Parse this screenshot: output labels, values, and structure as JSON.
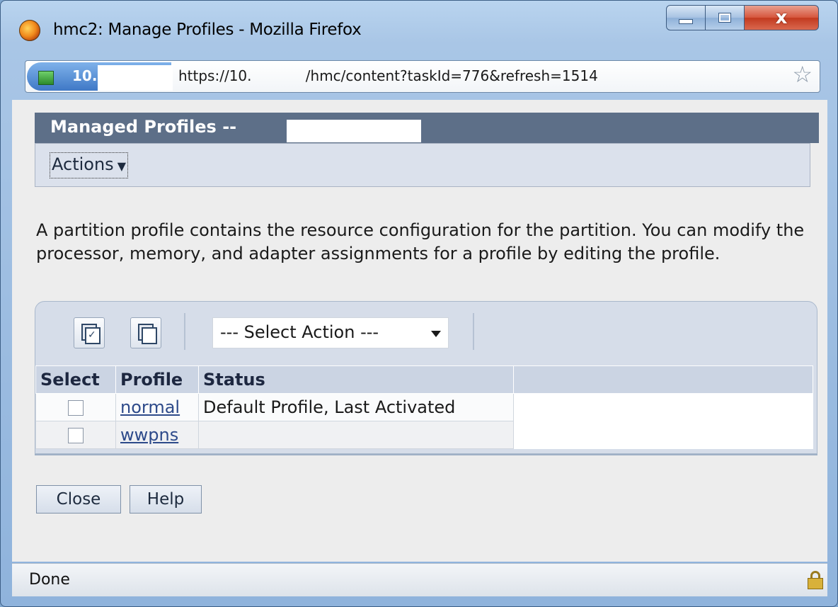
{
  "window": {
    "title": "hmc2: Manage Profiles - Mozilla Firefox",
    "controls": [
      "minimize-icon",
      "maximize-icon",
      "close-icon"
    ]
  },
  "urlbar": {
    "site_identity": "10.",
    "url": "https://10.            /hmc/content?taskId=776&refresh=1514",
    "bookmark_icon": "star-icon"
  },
  "page": {
    "header_title": "Managed Profiles --",
    "actions_menu_label": "Actions",
    "description": "A partition profile contains the resource configuration for the partition. You can modify the processor, memory, and adapter assignments for a profile by editing the profile.",
    "toolbar": {
      "select_all_icon": "select-all-icon",
      "deselect_all_icon": "deselect-all-icon",
      "select_action_label": "--- Select Action ---"
    },
    "table": {
      "columns": [
        "Select",
        "Profile",
        "Status"
      ],
      "rows": [
        {
          "checked": false,
          "profile": "normal",
          "status": "Default Profile, Last Activated"
        },
        {
          "checked": false,
          "profile": "wwpns",
          "status": ""
        }
      ]
    },
    "buttons": {
      "close": "Close",
      "help": "Help"
    }
  },
  "statusbar": {
    "text": "Done",
    "icon": "lock-icon"
  },
  "colors": {
    "header_bg": "#5d6f88",
    "link": "#2d4a8a",
    "content_bg": "#ededed"
  }
}
